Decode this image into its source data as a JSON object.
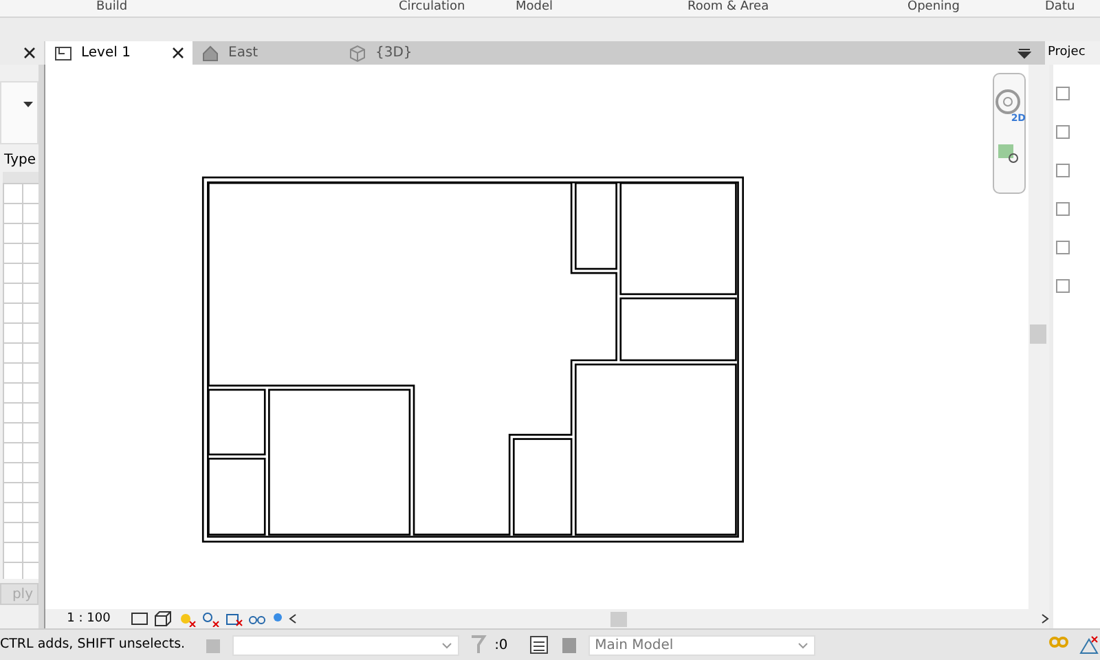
{
  "ribbon": {
    "panels": [
      "Build",
      "Circulation",
      "Model",
      "Room & Area",
      "Opening",
      "Datu"
    ]
  },
  "properties": {
    "type_label": "Type",
    "apply_button": "ply"
  },
  "view_tabs": [
    {
      "label": "Level 1",
      "selected": true,
      "kind": "plan"
    },
    {
      "label": "East",
      "selected": false,
      "kind": "elevation"
    },
    {
      "label": "{3D}",
      "selected": false,
      "kind": "isometric"
    }
  ],
  "navigation_bar": {
    "wheel_badge": "2D"
  },
  "project_browser": {
    "title": "Projec"
  },
  "view_control_bar": {
    "scale": "1 : 100"
  },
  "status_bar": {
    "message": "CTRL adds, SHIFT unselects.",
    "selection_count": ":0",
    "workset": "Main Model"
  }
}
